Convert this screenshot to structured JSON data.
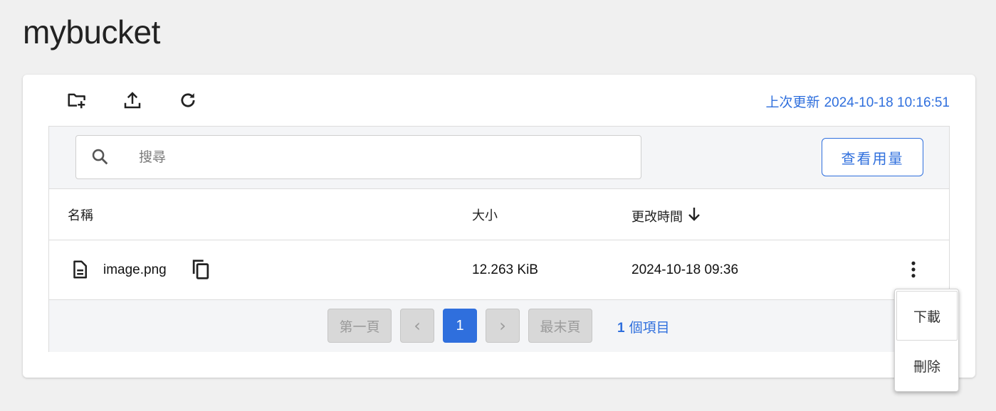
{
  "page": {
    "title": "mybucket"
  },
  "toolbar": {
    "new_folder_icon": "create-new-folder-icon",
    "upload_icon": "upload-icon",
    "refresh_icon": "refresh-icon",
    "last_updated_label": "上次更新",
    "last_updated_value": "2024-10-18 10:16:51"
  },
  "search": {
    "placeholder": "搜尋",
    "value": ""
  },
  "usage_button": {
    "label": "查看用量"
  },
  "table": {
    "headers": {
      "name": "名稱",
      "size": "大小",
      "modified": "更改時間"
    },
    "sort": {
      "column": "modified",
      "direction": "desc"
    },
    "rows": [
      {
        "name": "image.png",
        "size": "12.263 KiB",
        "modified": "2024-10-18 09:36"
      }
    ]
  },
  "pagination": {
    "first_label": "第一頁",
    "prev_label": "‹",
    "current_page": "1",
    "next_label": "›",
    "last_label": "最末頁",
    "item_count": "1",
    "item_count_label": "個項目"
  },
  "context_menu": {
    "items": [
      {
        "label": "下載"
      },
      {
        "label": "刪除"
      }
    ]
  },
  "colors": {
    "accent": "#2f6fdd",
    "background": "#f0f0f0",
    "panel_bg": "#f4f5f7",
    "disabled_button": "#d8d8d8"
  }
}
